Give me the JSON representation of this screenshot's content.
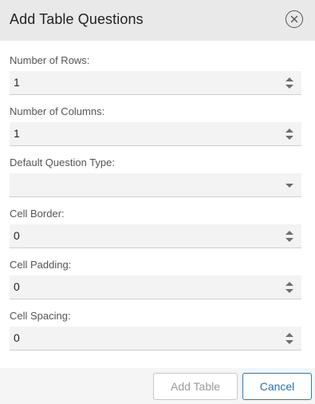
{
  "dialog": {
    "title": "Add Table Questions",
    "close_icon": "close-circle-icon"
  },
  "fields": {
    "rows": {
      "label": "Number of Rows:",
      "value": "1"
    },
    "columns": {
      "label": "Number of Columns:",
      "value": "1"
    },
    "question_type": {
      "label": "Default Question Type:",
      "value": ""
    },
    "cell_border": {
      "label": "Cell Border:",
      "value": "0"
    },
    "cell_padding": {
      "label": "Cell Padding:",
      "value": "0"
    },
    "cell_spacing": {
      "label": "Cell Spacing:",
      "value": "0"
    }
  },
  "footer": {
    "add_label": "Add Table",
    "cancel_label": "Cancel"
  },
  "colors": {
    "header_bg": "#e9e9e9",
    "field_bg": "#f3f3f3",
    "accent": "#2b7bb9"
  }
}
